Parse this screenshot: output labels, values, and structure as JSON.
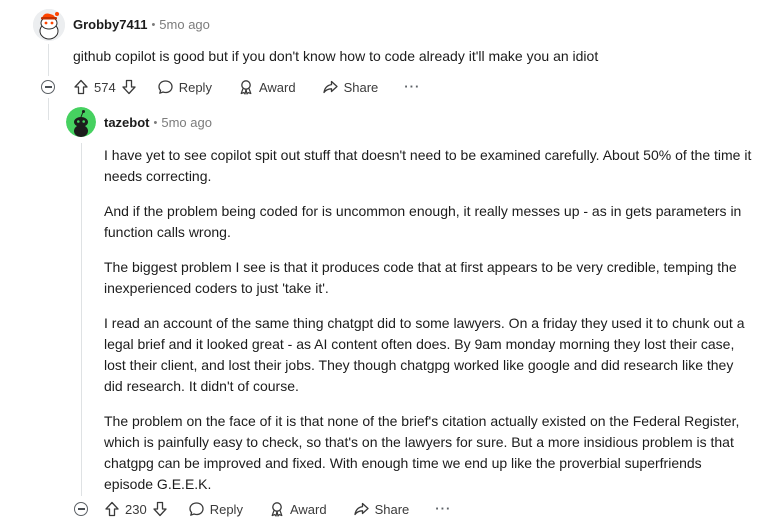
{
  "comment1": {
    "username": "Grobby7411",
    "separator": "•",
    "time": "5mo ago",
    "text": "github copilot is good but if you don't know how to code already it'll make you an idiot",
    "votes": "574",
    "reply_label": "Reply",
    "award_label": "Award",
    "share_label": "Share",
    "more_label": "···"
  },
  "comment2": {
    "username": "tazebot",
    "separator": "•",
    "time": "5mo ago",
    "paragraphs": [
      "I have yet to see copilot spit out stuff that doesn't need to be examined carefully. About 50% of the time it needs correcting.",
      "And if the problem being coded for is uncommon enough, it really messes up - as in gets parameters in function calls wrong.",
      "The biggest problem I see is that it produces code that at first appears to be very credible, temping the inexperienced coders to just 'take it'.",
      "I read an account of the same thing chatgpt did to some lawyers. On a friday they used it to chunk out a legal brief and it looked great - as AI content often does. By 9am monday morning they lost their case, lost their client, and lost their jobs. They though chatgpg worked like google and did research like they did research. It didn't of course.",
      "The problem on the face of it is that none of the brief's citation actually existed on the Federal Register, which is painfully easy to check, so that's on the lawyers for sure. But a more insidious problem is that chatgpg can be improved and fixed. With enough time we end up like the proverbial superfriends episode G.E.E.K."
    ],
    "votes": "230",
    "reply_label": "Reply",
    "award_label": "Award",
    "share_label": "Share",
    "more_label": "···"
  },
  "icons": {
    "upvote": "upvote-arrow-icon",
    "downvote": "downvote-arrow-icon",
    "reply": "speech-bubble-icon",
    "award": "award-ribbon-icon",
    "share": "share-arrow-icon",
    "collapse": "collapse-minus-icon"
  },
  "colors": {
    "username": "#1c1c1c",
    "meta": "#7c7c7c",
    "actions": "#3a3a3a",
    "thread_line": "#dfe2e4",
    "avatar1_bg": "#d7dadc",
    "avatar1_accent": "#ff4500",
    "avatar2_bg": "#46d160"
  }
}
